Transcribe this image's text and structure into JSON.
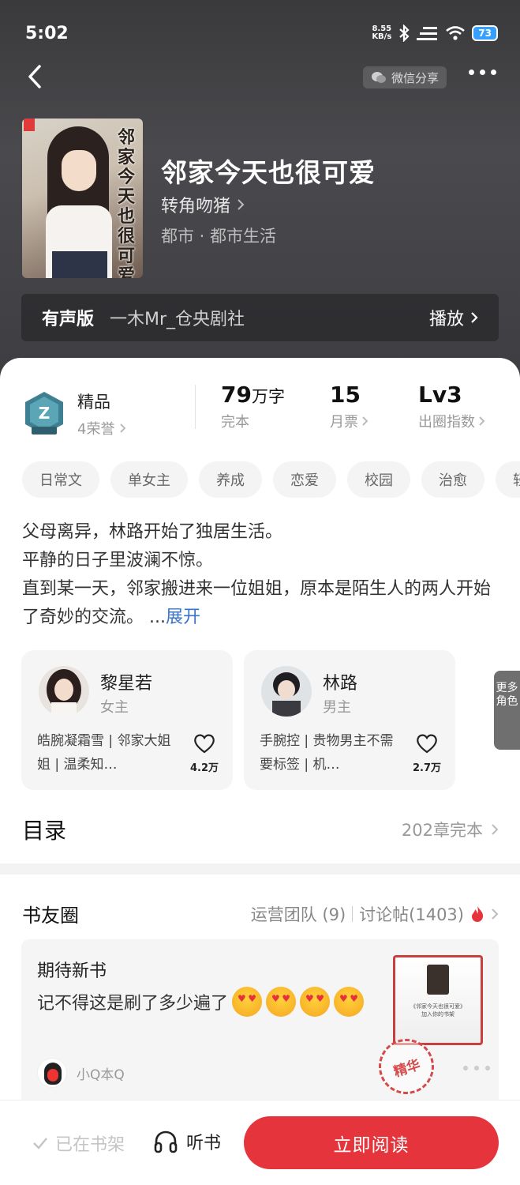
{
  "status": {
    "time": "5:02",
    "net_speed_value": "8.55",
    "net_speed_unit": "KB/s",
    "battery": "73"
  },
  "header": {
    "share_label": "微信分享"
  },
  "book": {
    "cover_title": "邻家今天也很可爱",
    "title": "邻家今天也很可爱",
    "author": "转角吻猪",
    "genre": "都市 · 都市生活"
  },
  "audio": {
    "label": "有声版",
    "performer": "一木Mr_仓央剧社",
    "play_label": "播放"
  },
  "stats": {
    "honor_title": "精品",
    "honor_count": "4荣誉",
    "words_value": "79",
    "words_unit": "万字",
    "words_label": "完本",
    "tickets_value": "15",
    "tickets_label": "月票",
    "level_value": "Lv3",
    "level_label": "出圈指数"
  },
  "tags": [
    "日常文",
    "单女主",
    "养成",
    "恋爱",
    "校园",
    "治愈",
    "轻"
  ],
  "synopsis": {
    "line1": "父母离异，林路开始了独居生活。",
    "line2": "平静的日子里波澜不惊。",
    "line3": "直到某一天，邻家搬进来一位姐姐，原本是陌生人的两人开始了奇妙的交流。",
    "ellipsis": "...",
    "expand_label": "展开"
  },
  "roles": [
    {
      "name": "黎星若",
      "gender": "女主",
      "desc": "皓腕凝霜雪 | 邻家大姐姐 | 温柔知…",
      "likes": "4.2万"
    },
    {
      "name": "林路",
      "gender": "男主",
      "desc": "手腕控 | 贵物男主不需要标签 | 机…",
      "likes": "2.7万"
    }
  ],
  "more_roles_label": "更多角色",
  "toc": {
    "title": "目录",
    "chapters": "202章完本"
  },
  "circle": {
    "title": "书友圈",
    "team": "运营团队 (9)",
    "posts": "讨论帖(1403)",
    "post_title": "期待新书",
    "post_body": "记不得这是刷了多少遍了",
    "post_user": "小Q本Q",
    "thumb_line1": "《邻家今天也很可爱》",
    "thumb_line2": "加入你的书架",
    "stamp": "精华"
  },
  "bottom": {
    "shelf_label": "已在书架",
    "listen_label": "听书",
    "read_label": "立即阅读"
  },
  "colors": {
    "accent": "#e5343c",
    "link": "#3a74c9",
    "hero_bg": "#3f3f43"
  }
}
